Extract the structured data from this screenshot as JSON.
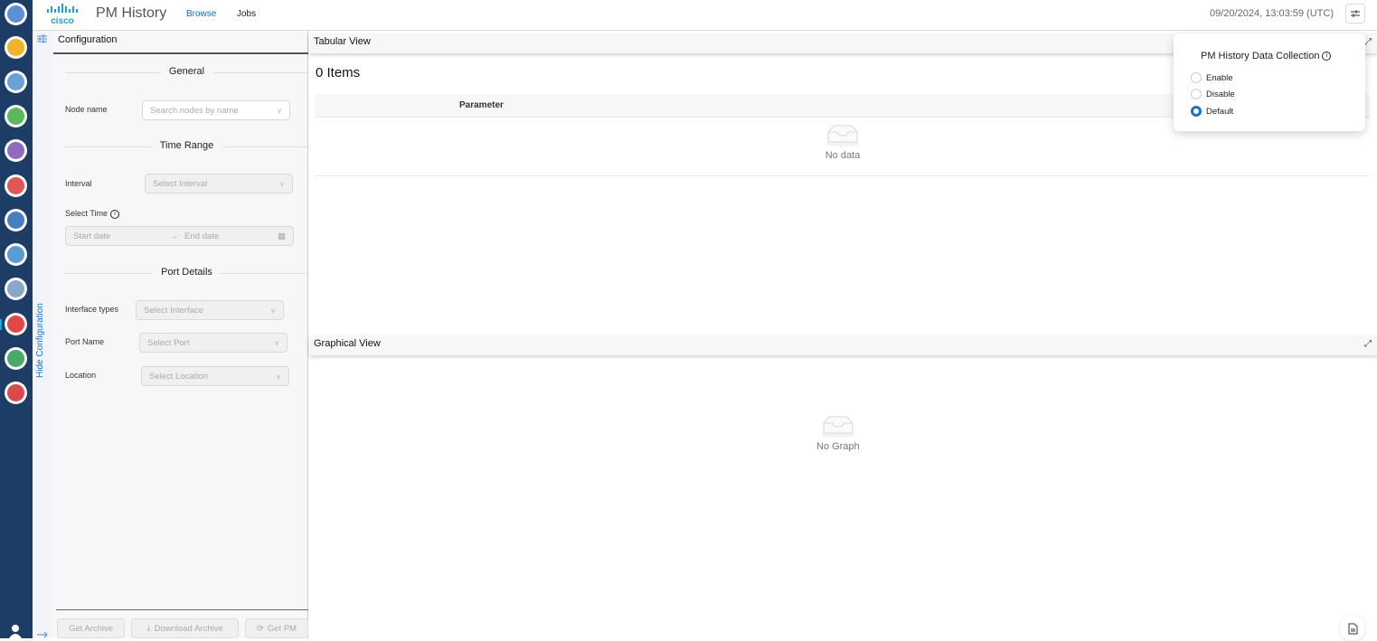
{
  "header": {
    "brand": "cisco",
    "app_title": "PM History",
    "tabs": [
      {
        "label": "Browse",
        "active": true
      },
      {
        "label": "Jobs",
        "active": false
      }
    ],
    "timestamp": "09/20/2024, 13:03:59 (UTC)"
  },
  "rail": {
    "icons": [
      {
        "name": "home-globe-icon",
        "color": "#5b8fd6"
      },
      {
        "name": "devices-icon",
        "color": "#f0b429"
      },
      {
        "name": "import-icon",
        "color": "#6aa0d8"
      },
      {
        "name": "inventory-icon",
        "color": "#5cb85c"
      },
      {
        "name": "add-circuit-icon",
        "color": "#8e6bbf"
      },
      {
        "name": "alarm-icon",
        "color": "#e05555"
      },
      {
        "name": "dashboard-icon",
        "color": "#4a7cc0"
      },
      {
        "name": "topology-icon",
        "color": "#5b9bd5"
      },
      {
        "name": "sync-icon",
        "color": "#8aa6c8"
      },
      {
        "name": "performance-icon",
        "color": "#e04848"
      },
      {
        "name": "network-icon",
        "color": "#4aa86a"
      },
      {
        "name": "pm-history-icon",
        "color": "#d94b4b"
      }
    ]
  },
  "side_strip": {
    "hide_label": "Hide Configuration"
  },
  "config": {
    "title": "Configuration",
    "sections": {
      "general": "General",
      "time_range": "Time Range",
      "port_details": "Port Details"
    },
    "fields": {
      "node_name": {
        "label": "Node name",
        "placeholder": "Search nodes by name"
      },
      "interval": {
        "label": "Interval",
        "placeholder": "Select Interval"
      },
      "select_time": {
        "label": "Select Time",
        "start_placeholder": "Start date",
        "end_placeholder": "End date"
      },
      "interface_types": {
        "label": "Interface types",
        "placeholder": "Select Interface"
      },
      "port_name": {
        "label": "Port Name",
        "placeholder": "Select Port"
      },
      "location": {
        "label": "Location",
        "placeholder": "Select Location"
      }
    },
    "buttons": {
      "get_archive": "Get Archive",
      "download_archive": "Download Archive",
      "get_pm": "Get PM"
    }
  },
  "tabular": {
    "title": "Tabular View",
    "items_count": "0 Items",
    "columns": [
      "Parameter"
    ],
    "rows": [],
    "empty_text": "No data"
  },
  "graphical": {
    "title": "Graphical View",
    "empty_text": "No Graph"
  },
  "popover": {
    "title": "PM History Data Collection",
    "options": [
      {
        "label": "Enable",
        "checked": false
      },
      {
        "label": "Disable",
        "checked": false
      },
      {
        "label": "Default",
        "checked": true
      }
    ]
  }
}
